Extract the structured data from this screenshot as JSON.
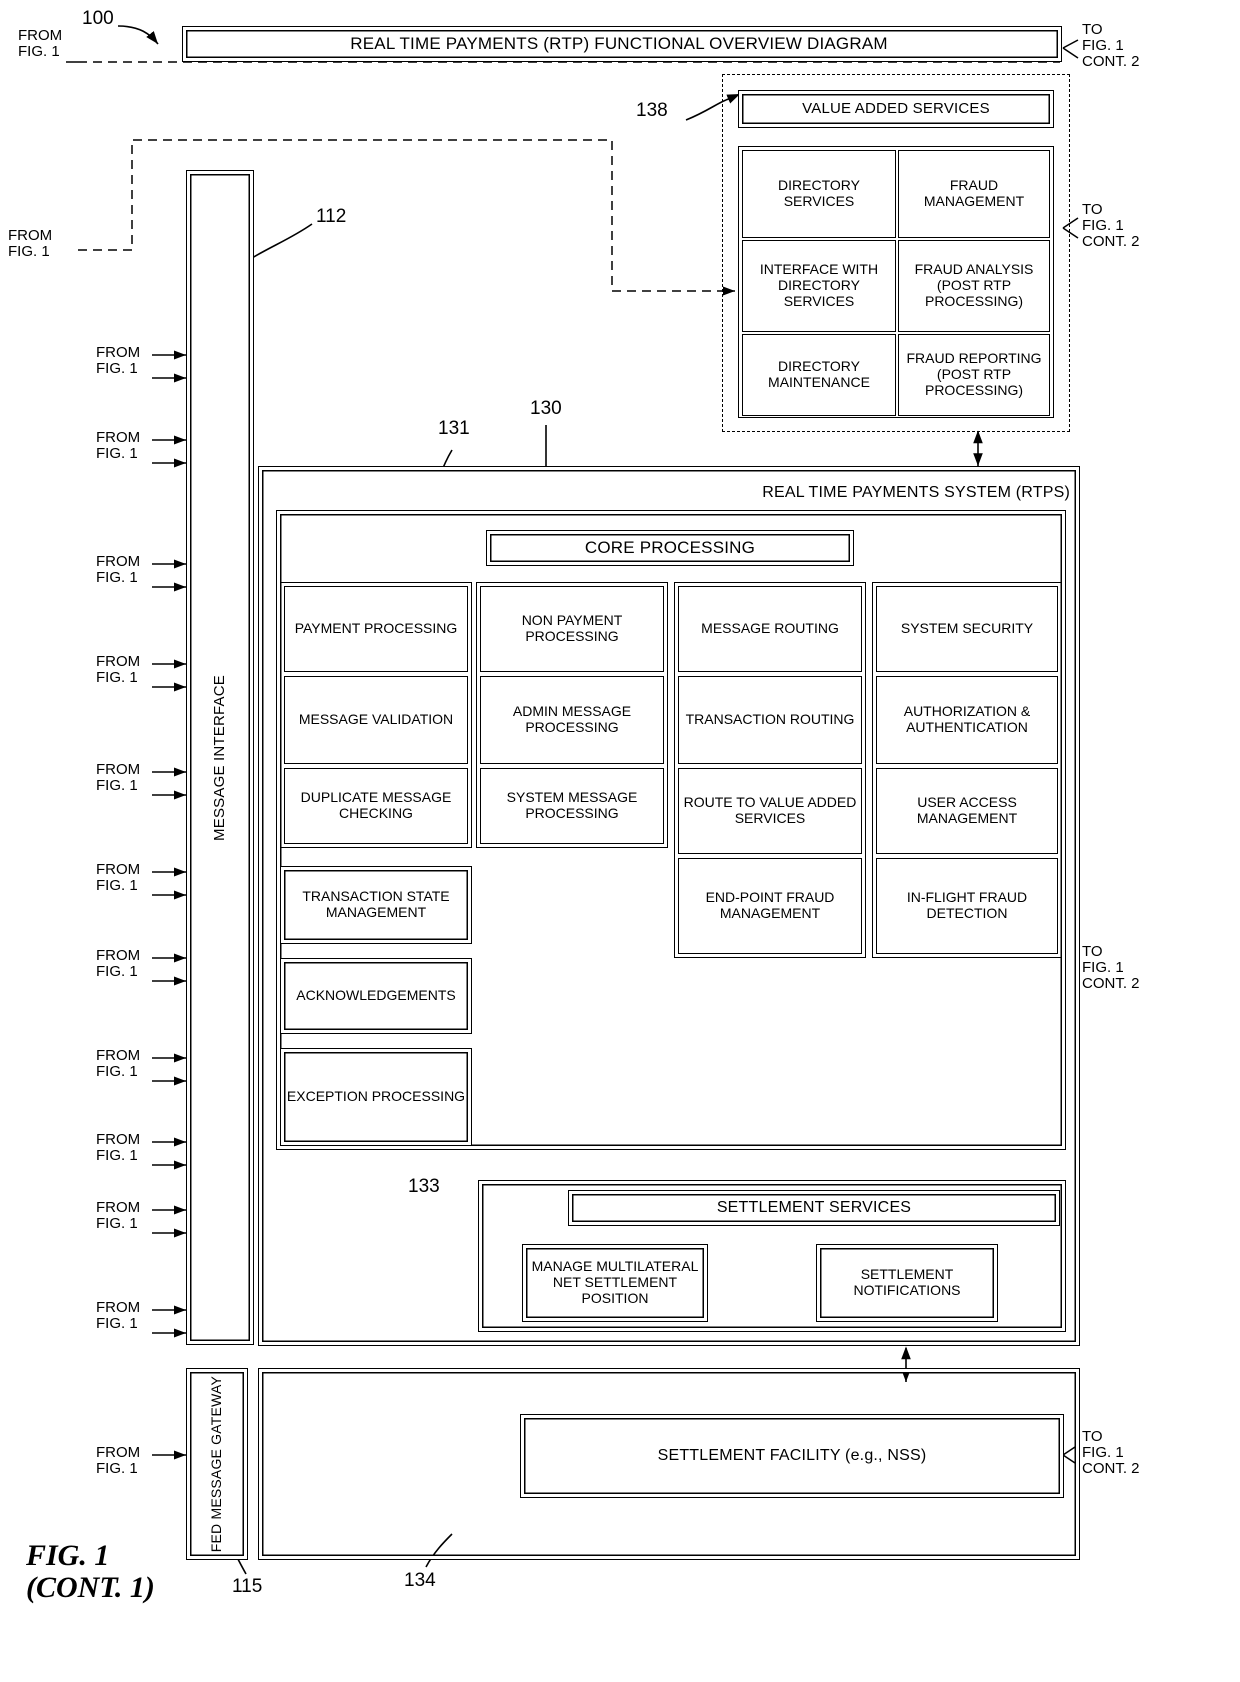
{
  "figure": {
    "title": "REAL TIME PAYMENTS (RTP) FUNCTIONAL OVERVIEW DIAGRAM",
    "fig_label_line1": "FIG. 1",
    "fig_label_line2": "(CONT. 1)",
    "ref_numbers": {
      "n100": "100",
      "n112": "112",
      "n115": "115",
      "n130": "130",
      "n131": "131",
      "n133": "133",
      "n134": "134",
      "n138": "138"
    }
  },
  "connectors": {
    "from_label_line1": "FROM",
    "from_label_line2": "FIG. 1",
    "to_label_line1": "TO",
    "to_label_line2": "FIG. 1",
    "to_label_line3": "CONT. 2",
    "from_left": [
      "FROM FIG. 1",
      "FROM FIG. 1",
      "FROM FIG. 1",
      "FROM FIG. 1",
      "FROM FIG. 1",
      "FROM FIG. 1",
      "FROM FIG. 1",
      "FROM FIG. 1",
      "FROM FIG. 1",
      "FROM FIG. 1",
      "FROM FIG. 1",
      "FROM FIG. 1",
      "FROM FIG. 1"
    ]
  },
  "blocks": {
    "message_interface": "MESSAGE INTERFACE",
    "fed_message_gateway": "FED MESSAGE GATEWAY",
    "value_added_services": "VALUE ADDED SERVICES",
    "vas_items": [
      "DIRECTORY SERVICES",
      "FRAUD MANAGEMENT",
      "INTERFACE WITH DIRECTORY SERVICES",
      "FRAUD ANALYSIS (POST RTP PROCESSING)",
      "DIRECTORY MAINTENANCE",
      "FRAUD REPORTING (POST RTP PROCESSING)"
    ],
    "rtps_title": "REAL TIME PAYMENTS SYSTEM (RTPS)",
    "core_processing": "CORE PROCESSING",
    "core_columns": [
      {
        "group": "payment",
        "items": [
          "PAYMENT PROCESSING",
          "MESSAGE VALIDATION",
          "DUPLICATE MESSAGE CHECKING"
        ],
        "extra": [
          "TRANSACTION STATE MANAGEMENT",
          "ACKNOWLEDGEMENTS",
          "EXCEPTION PROCESSING"
        ]
      },
      {
        "group": "non-payment",
        "items": [
          "NON PAYMENT PROCESSING",
          "ADMIN MESSAGE PROCESSING",
          "SYSTEM MESSAGE PROCESSING"
        ],
        "extra": []
      },
      {
        "group": "routing",
        "items": [
          "MESSAGE ROUTING",
          "TRANSACTION ROUTING",
          "ROUTE TO VALUE ADDED SERVICES",
          "END-POINT FRAUD MANAGEMENT"
        ],
        "extra": []
      },
      {
        "group": "security",
        "items": [
          "SYSTEM SECURITY",
          "AUTHORIZATION & AUTHENTICATION",
          "USER ACCESS MANAGEMENT",
          "IN-FLIGHT FRAUD DETECTION"
        ],
        "extra": []
      }
    ],
    "settlement_services": "SETTLEMENT SERVICES",
    "settlement_items": [
      "MANAGE MULTILATERAL NET SETTLEMENT POSITION",
      "SETTLEMENT NOTIFICATIONS"
    ],
    "settlement_facility": "SETTLEMENT FACILITY (e.g., NSS)"
  }
}
